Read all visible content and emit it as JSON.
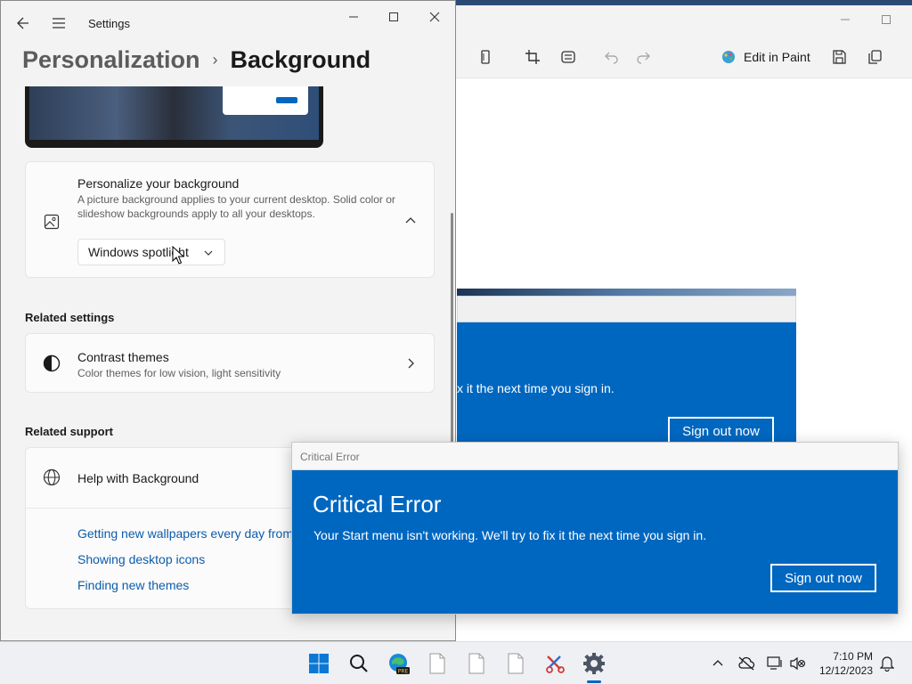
{
  "settings": {
    "window_title": "Settings",
    "breadcrumb": {
      "parent": "Personalization",
      "separator": "›",
      "current": "Background"
    },
    "personalize": {
      "title": "Personalize your background",
      "description": "A picture background applies to your current desktop. Solid color or slideshow backgrounds apply to all your desktops.",
      "dropdown_value": "Windows spotlight"
    },
    "related_settings": {
      "heading": "Related settings",
      "contrast_title": "Contrast themes",
      "contrast_sub": "Color themes for low vision, light sensitivity"
    },
    "related_support": {
      "heading": "Related support",
      "help_title": "Help with Background",
      "links": [
        "Getting new wallpapers every day from",
        "Showing desktop icons",
        "Finding new themes"
      ]
    }
  },
  "photos": {
    "edit_in_paint": "Edit in Paint",
    "inner_message": "x it the next time you sign in.",
    "inner_button": "Sign out now"
  },
  "dialog": {
    "window_title": "Critical Error",
    "heading": "Critical Error",
    "message": "Your Start menu isn't working. We'll try to fix it the next time you sign in.",
    "button": "Sign out now"
  },
  "taskbar": {
    "time": "7:10 PM",
    "date": "12/12/2023",
    "edge_badge": "PRE"
  },
  "colors": {
    "accent": "#0067c0",
    "link": "#0b5cad"
  }
}
